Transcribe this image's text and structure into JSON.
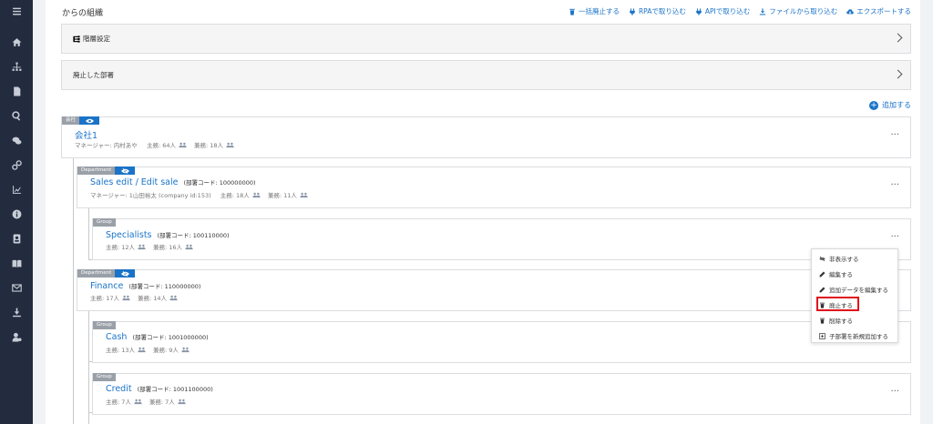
{
  "page": {
    "title": "からの組織",
    "toolbar": [
      {
        "label": "一括廃止する",
        "icon": "trash-icon"
      },
      {
        "label": "RPAで取り込む",
        "icon": "plug-icon"
      },
      {
        "label": "APIで取り込む",
        "icon": "plug-icon"
      },
      {
        "label": "ファイルから取り込む",
        "icon": "download-icon"
      },
      {
        "label": "エクスポートする",
        "icon": "cloud-download-icon"
      }
    ],
    "panels": [
      {
        "label": "階層設定",
        "icon": "hierarchy-icon"
      },
      {
        "label": "廃止した部署"
      }
    ],
    "add_label": "追加する"
  },
  "tree": {
    "company": {
      "tag": "会社",
      "name": "会社1",
      "manager": "マネージャー: 内村あや",
      "main": "主務: 64人",
      "sub": "兼務: 18人"
    },
    "sales": {
      "tag": "Department",
      "name": "Sales edit / Edit sale",
      "code": "(部署コード: 100000000)",
      "manager": "マネージャー: 1山田裕太 (company id:153)",
      "main": "主務: 18人",
      "sub": "兼務: 11人"
    },
    "specialists": {
      "tag": "Group",
      "name": "Specialists",
      "code": "(部署コード: 100110000)",
      "main": "主務: 12人",
      "sub": "兼務: 16人"
    },
    "finance": {
      "tag": "Department",
      "name": "Finance",
      "code": "(部署コード: 110000000)",
      "main": "主務: 17人",
      "sub": "兼務: 14人"
    },
    "cash": {
      "tag": "Group",
      "name": "Cash",
      "code": "(部署コード: 1001000000)",
      "main": "主務: 13人",
      "sub": "兼務: 9人"
    },
    "credit": {
      "tag": "Group",
      "name": "Credit",
      "code": "(部署コード: 1001100000)",
      "main": "主務: 7人",
      "sub": "兼務: 7人"
    }
  },
  "more_label": "···",
  "context_menu": [
    {
      "label": "非表示する",
      "icon": "eye-slash-icon"
    },
    {
      "label": "編集する",
      "icon": "pencil-icon"
    },
    {
      "label": "追加データを編集する",
      "icon": "pencil-icon"
    },
    {
      "label": "廃止する",
      "icon": "trash-icon"
    },
    {
      "label": "削除する",
      "icon": "trash-icon"
    },
    {
      "label": "子部署を新規追加する",
      "icon": "plus-square-icon"
    }
  ],
  "colors": {
    "accent": "#1a73c8",
    "nav_bg": "#232b3e",
    "highlight": "#e0101a"
  }
}
